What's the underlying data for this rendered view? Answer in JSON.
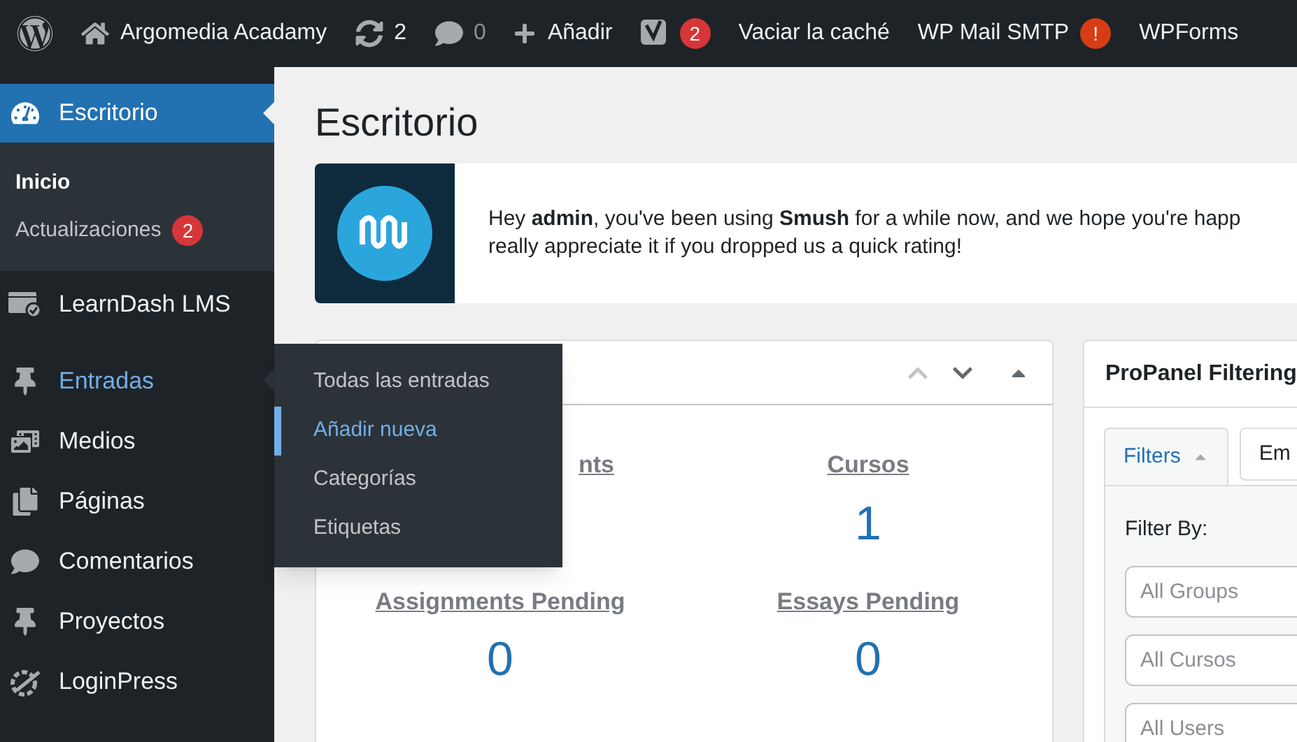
{
  "admin_bar": {
    "site_name": "Argomedia Acadamy",
    "updates_count": "2",
    "comments_count": "0",
    "new_label": "Añadir",
    "seo_count": "2",
    "items": [
      "Vaciar la caché",
      "WP Mail SMTP",
      "WPForms"
    ],
    "smtp_alert": "!"
  },
  "sidebar": {
    "items": [
      {
        "label": "Escritorio",
        "kind": "dashboard",
        "selected": true,
        "hovered": false,
        "children": [
          {
            "label": "Inicio",
            "selected": true
          },
          {
            "label": "Actualizaciones",
            "selected": false,
            "badge": "2"
          }
        ]
      },
      {
        "label": "LearnDash LMS",
        "kind": "learndash",
        "selected": false,
        "hovered": false
      },
      {
        "label": "Entradas",
        "kind": "pin",
        "selected": false,
        "hovered": true
      },
      {
        "label": "Medios",
        "kind": "media",
        "selected": false,
        "hovered": false
      },
      {
        "label": "Páginas",
        "kind": "pages",
        "selected": false,
        "hovered": false
      },
      {
        "label": "Comentarios",
        "kind": "comment",
        "selected": false,
        "hovered": false
      },
      {
        "label": "Proyectos",
        "kind": "pin",
        "selected": false,
        "hovered": false
      },
      {
        "label": "LoginPress",
        "kind": "loginpress",
        "selected": false,
        "hovered": false
      }
    ]
  },
  "flyout": {
    "items": [
      {
        "label": "Todas las entradas",
        "selected": false
      },
      {
        "label": "Añadir nueva",
        "selected": true
      },
      {
        "label": "Categorías",
        "selected": false
      },
      {
        "label": "Etiquetas",
        "selected": false
      }
    ]
  },
  "page_title": "Escritorio",
  "notice": {
    "text": "Hey **admin**, you've been using **Smush** for a while now, and we hope you're happ",
    "text_2": "really appreciate it if you dropped us a quick rating!"
  },
  "stats_box": {
    "stats": [
      {
        "label": "nts"
      },
      {
        "label": "Cursos",
        "value": "1"
      },
      {
        "label": "Assignments Pending",
        "value": "0"
      },
      {
        "label": "Essays Pending",
        "value": "0"
      }
    ]
  },
  "propanel": {
    "title": "ProPanel Filtering",
    "tabs": [
      {
        "label": "Filters",
        "selected": true
      },
      {
        "label": "Em",
        "selected": false
      }
    ],
    "filter_by": "Filter By:",
    "fields": [
      {
        "placeholder": "All Groups"
      },
      {
        "placeholder": "All Cursos"
      },
      {
        "placeholder": "All Users"
      }
    ]
  }
}
